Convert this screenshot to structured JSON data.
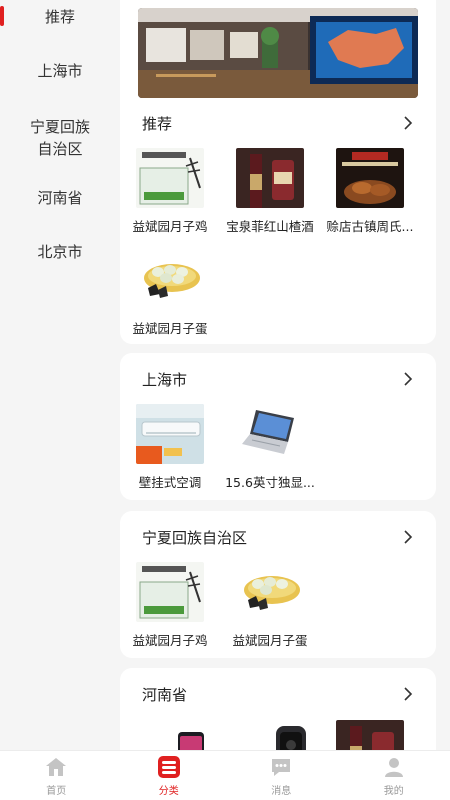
{
  "sidebar": {
    "items": [
      {
        "label": "推荐",
        "active": true
      },
      {
        "label": "上海市",
        "active": false
      },
      {
        "label": "宁夏回族自治区",
        "active": false
      },
      {
        "label": "河南省",
        "active": false
      },
      {
        "label": "北京市",
        "active": false
      }
    ]
  },
  "sections": [
    {
      "title": "推荐",
      "products": [
        {
          "name": "益斌园月子鸡"
        },
        {
          "name": "宝泉菲红山楂酒"
        },
        {
          "name": "赊店古镇周氏..."
        },
        {
          "name": "益斌园月子蛋"
        }
      ]
    },
    {
      "title": "上海市",
      "products": [
        {
          "name": "壁挂式空调"
        },
        {
          "name": "15.6英寸独显..."
        }
      ]
    },
    {
      "title": "宁夏回族自治区",
      "products": [
        {
          "name": "益斌园月子鸡"
        },
        {
          "name": "益斌园月子蛋"
        }
      ]
    },
    {
      "title": "河南省",
      "products": []
    }
  ],
  "tabbar": {
    "items": [
      {
        "label": "首页",
        "icon": "home-icon",
        "active": false
      },
      {
        "label": "分类",
        "icon": "category-icon",
        "active": true
      },
      {
        "label": "消息",
        "icon": "message-icon",
        "active": false
      },
      {
        "label": "我的",
        "icon": "profile-icon",
        "active": false
      }
    ]
  },
  "colors": {
    "accent": "#e02020",
    "inactive": "#bbbbbb",
    "background": "#f5f5f5"
  }
}
